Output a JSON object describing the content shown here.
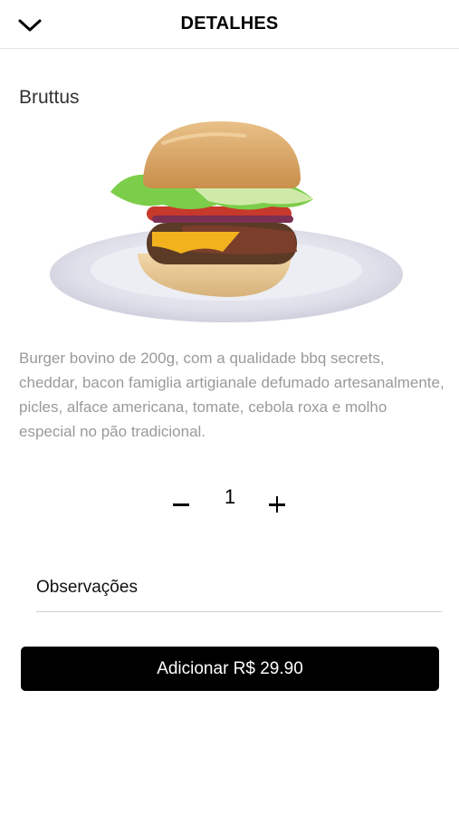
{
  "header": {
    "title": "DETALHES",
    "back_icon": "chevron-down-icon"
  },
  "product": {
    "name": "Bruttus",
    "description": "Burger bovino de 200g, com a qualidade bbq secrets, cheddar, bacon famiglia artigianale defumado artesanalmente, picles, alface americana, tomate, cebola roxa e molho especial no pão tradicional."
  },
  "quantity": {
    "value": "1",
    "minus_icon": "minus-icon",
    "plus_icon": "plus-icon"
  },
  "notes": {
    "placeholder": "Observações",
    "value": ""
  },
  "add_button": {
    "label": "Adicionar R$ 29.90"
  },
  "colors": {
    "primary": "#000000",
    "text_muted": "#9a9a9a",
    "background": "#ffffff"
  }
}
